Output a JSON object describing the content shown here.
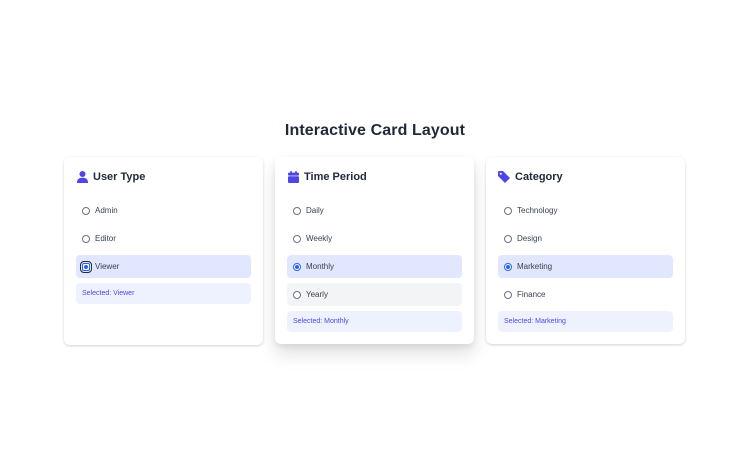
{
  "page": {
    "title": "Interactive Card Layout"
  },
  "colors": {
    "accent": "#4f46e5",
    "selected_bg": "#e0e7ff",
    "summary_bg": "#eef2ff",
    "radio_checked": "#2563eb"
  },
  "cards": [
    {
      "title": "User Type",
      "icon": "user-icon",
      "options": [
        "Admin",
        "Editor",
        "Viewer"
      ],
      "selected_index": 2,
      "summary": "Selected: Viewer"
    },
    {
      "title": "Time Period",
      "icon": "calendar-icon",
      "options": [
        "Daily",
        "Weekly",
        "Monthly",
        "Yearly"
      ],
      "selected_index": 2,
      "hovered_index": 3,
      "summary": "Selected: Monthly"
    },
    {
      "title": "Category",
      "icon": "tag-icon",
      "options": [
        "Technology",
        "Design",
        "Marketing",
        "Finance"
      ],
      "selected_index": 2,
      "summary": "Selected: Marketing"
    }
  ]
}
